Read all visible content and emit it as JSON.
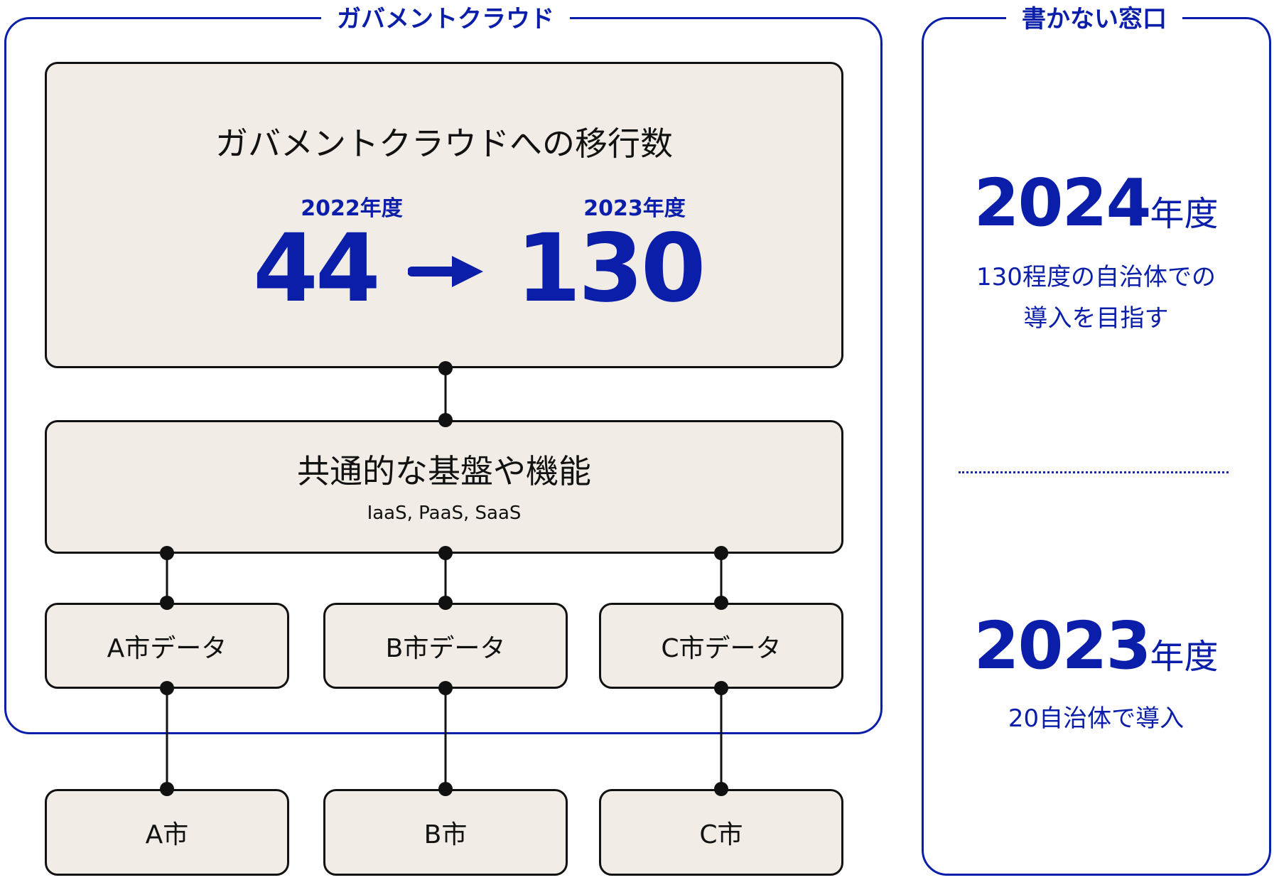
{
  "left_panel": {
    "title": "ガバメントクラウド",
    "migration_box": {
      "title": "ガバメントクラウドへの移行数",
      "from": {
        "year_label": "2022年度",
        "value": "44"
      },
      "arrow_icon": "arrow-right-icon",
      "to": {
        "year_label": "2023年度",
        "value": "130"
      }
    },
    "platform_box": {
      "title": "共通的な基盤や機能",
      "subtitle": "IaaS, PaaS, SaaS"
    },
    "data_boxes": [
      {
        "label": "A市データ"
      },
      {
        "label": "B市データ"
      },
      {
        "label": "C市データ"
      }
    ]
  },
  "cities": [
    {
      "label": "A市"
    },
    {
      "label": "B市"
    },
    {
      "label": "C市"
    }
  ],
  "right_panel": {
    "title": "書かない窓口",
    "stats": [
      {
        "year": "2024",
        "unit": "年度",
        "description_lines": [
          "130程度の自治体での",
          "導入を目指す"
        ]
      },
      {
        "year": "2023",
        "unit": "年度",
        "description_lines": [
          "20自治体で導入"
        ]
      }
    ]
  },
  "colors": {
    "accent": "#0a1eaa",
    "box_fill": "#f1ede6",
    "box_border": "#111111"
  }
}
